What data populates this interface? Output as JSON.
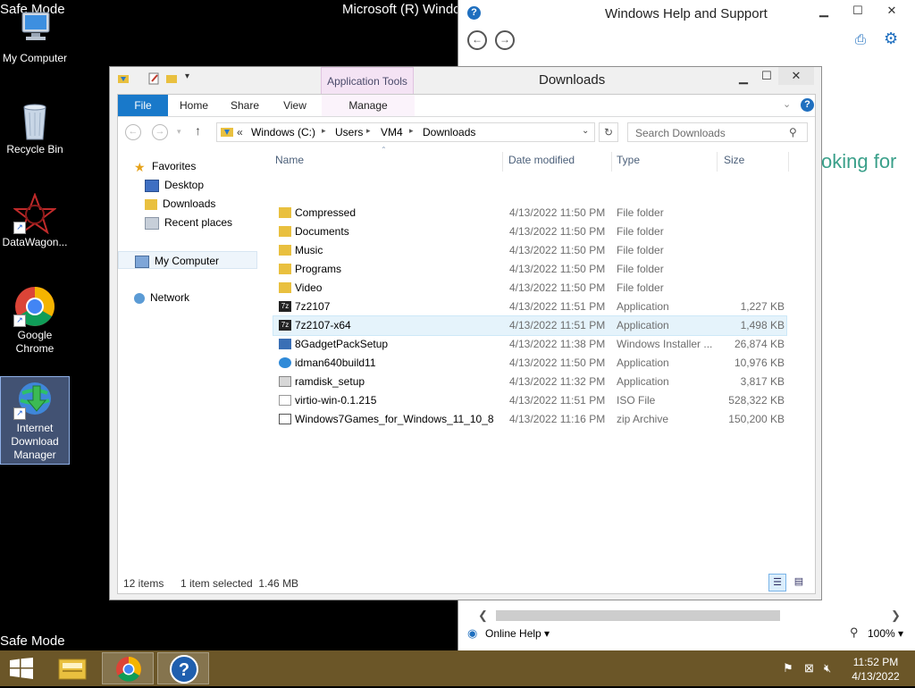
{
  "desktop": {
    "safe_mode_label": "Safe Mode",
    "os_title_fragment": "Microsoft (R) Windo",
    "icons": [
      {
        "label": "My Computer"
      },
      {
        "label": "Recycle Bin"
      },
      {
        "label": "DataWagon..."
      },
      {
        "label": "Google Chrome"
      },
      {
        "label": "Internet Download Manager"
      }
    ]
  },
  "help_window": {
    "title": "Windows Help and Support",
    "body_fragment": "oking for",
    "online_help_label": "Online Help",
    "zoom_label": "100%"
  },
  "explorer": {
    "title": "Downloads",
    "ribbon": {
      "file": "File",
      "home": "Home",
      "share": "Share",
      "view": "View",
      "context_group": "Application Tools",
      "manage": "Manage"
    },
    "address": {
      "prefix": "«",
      "crumbs": [
        "Windows (C:)",
        "Users",
        "VM4",
        "Downloads"
      ]
    },
    "search_placeholder": "Search Downloads",
    "columns": {
      "name": "Name",
      "date": "Date modified",
      "type": "Type",
      "size": "Size"
    },
    "nav": {
      "favorites": "Favorites",
      "desktop": "Desktop",
      "downloads": "Downloads",
      "recent": "Recent places",
      "my_computer": "My Computer",
      "network": "Network"
    },
    "files": [
      {
        "name": "Compressed",
        "date": "4/13/2022 11:50 PM",
        "type": "File folder",
        "size": "",
        "icon": "folder-icon"
      },
      {
        "name": "Documents",
        "date": "4/13/2022 11:50 PM",
        "type": "File folder",
        "size": "",
        "icon": "folder-icon"
      },
      {
        "name": "Music",
        "date": "4/13/2022 11:50 PM",
        "type": "File folder",
        "size": "",
        "icon": "folder-icon"
      },
      {
        "name": "Programs",
        "date": "4/13/2022 11:50 PM",
        "type": "File folder",
        "size": "",
        "icon": "folder-icon"
      },
      {
        "name": "Video",
        "date": "4/13/2022 11:50 PM",
        "type": "File folder",
        "size": "",
        "icon": "folder-icon"
      },
      {
        "name": "7z2107",
        "date": "4/13/2022 11:51 PM",
        "type": "Application",
        "size": "1,227 KB",
        "icon": "7zip-icon"
      },
      {
        "name": "7z2107-x64",
        "date": "4/13/2022 11:51 PM",
        "type": "Application",
        "size": "1,498 KB",
        "icon": "7zip-icon"
      },
      {
        "name": "8GadgetPackSetup",
        "date": "4/13/2022 11:38 PM",
        "type": "Windows Installer ...",
        "size": "26,874 KB",
        "icon": "installer-icon"
      },
      {
        "name": "idman640build11",
        "date": "4/13/2022 11:50 PM",
        "type": "Application",
        "size": "10,976 KB",
        "icon": "idm-icon"
      },
      {
        "name": "ramdisk_setup",
        "date": "4/13/2022 11:32 PM",
        "type": "Application",
        "size": "3,817 KB",
        "icon": "setup-icon"
      },
      {
        "name": "virtio-win-0.1.215",
        "date": "4/13/2022 11:51 PM",
        "type": "ISO File",
        "size": "528,322 KB",
        "icon": "iso-icon"
      },
      {
        "name": "Windows7Games_for_Windows_11_10_8",
        "date": "4/13/2022 11:16 PM",
        "type": "zip Archive",
        "size": "150,200 KB",
        "icon": "zip-icon"
      }
    ],
    "selected_index": 6,
    "status": {
      "count": "12 items",
      "selection": "1 item selected  1.46 MB"
    }
  },
  "taskbar": {
    "time": "11:52 PM",
    "date": "4/13/2022"
  },
  "colors": {
    "taskbar": "#6b5628",
    "ribbon_file": "#1979ca",
    "context_tab": "#f4e3f4",
    "selection": "#e5f3fb",
    "folder": "#e9c03f"
  }
}
